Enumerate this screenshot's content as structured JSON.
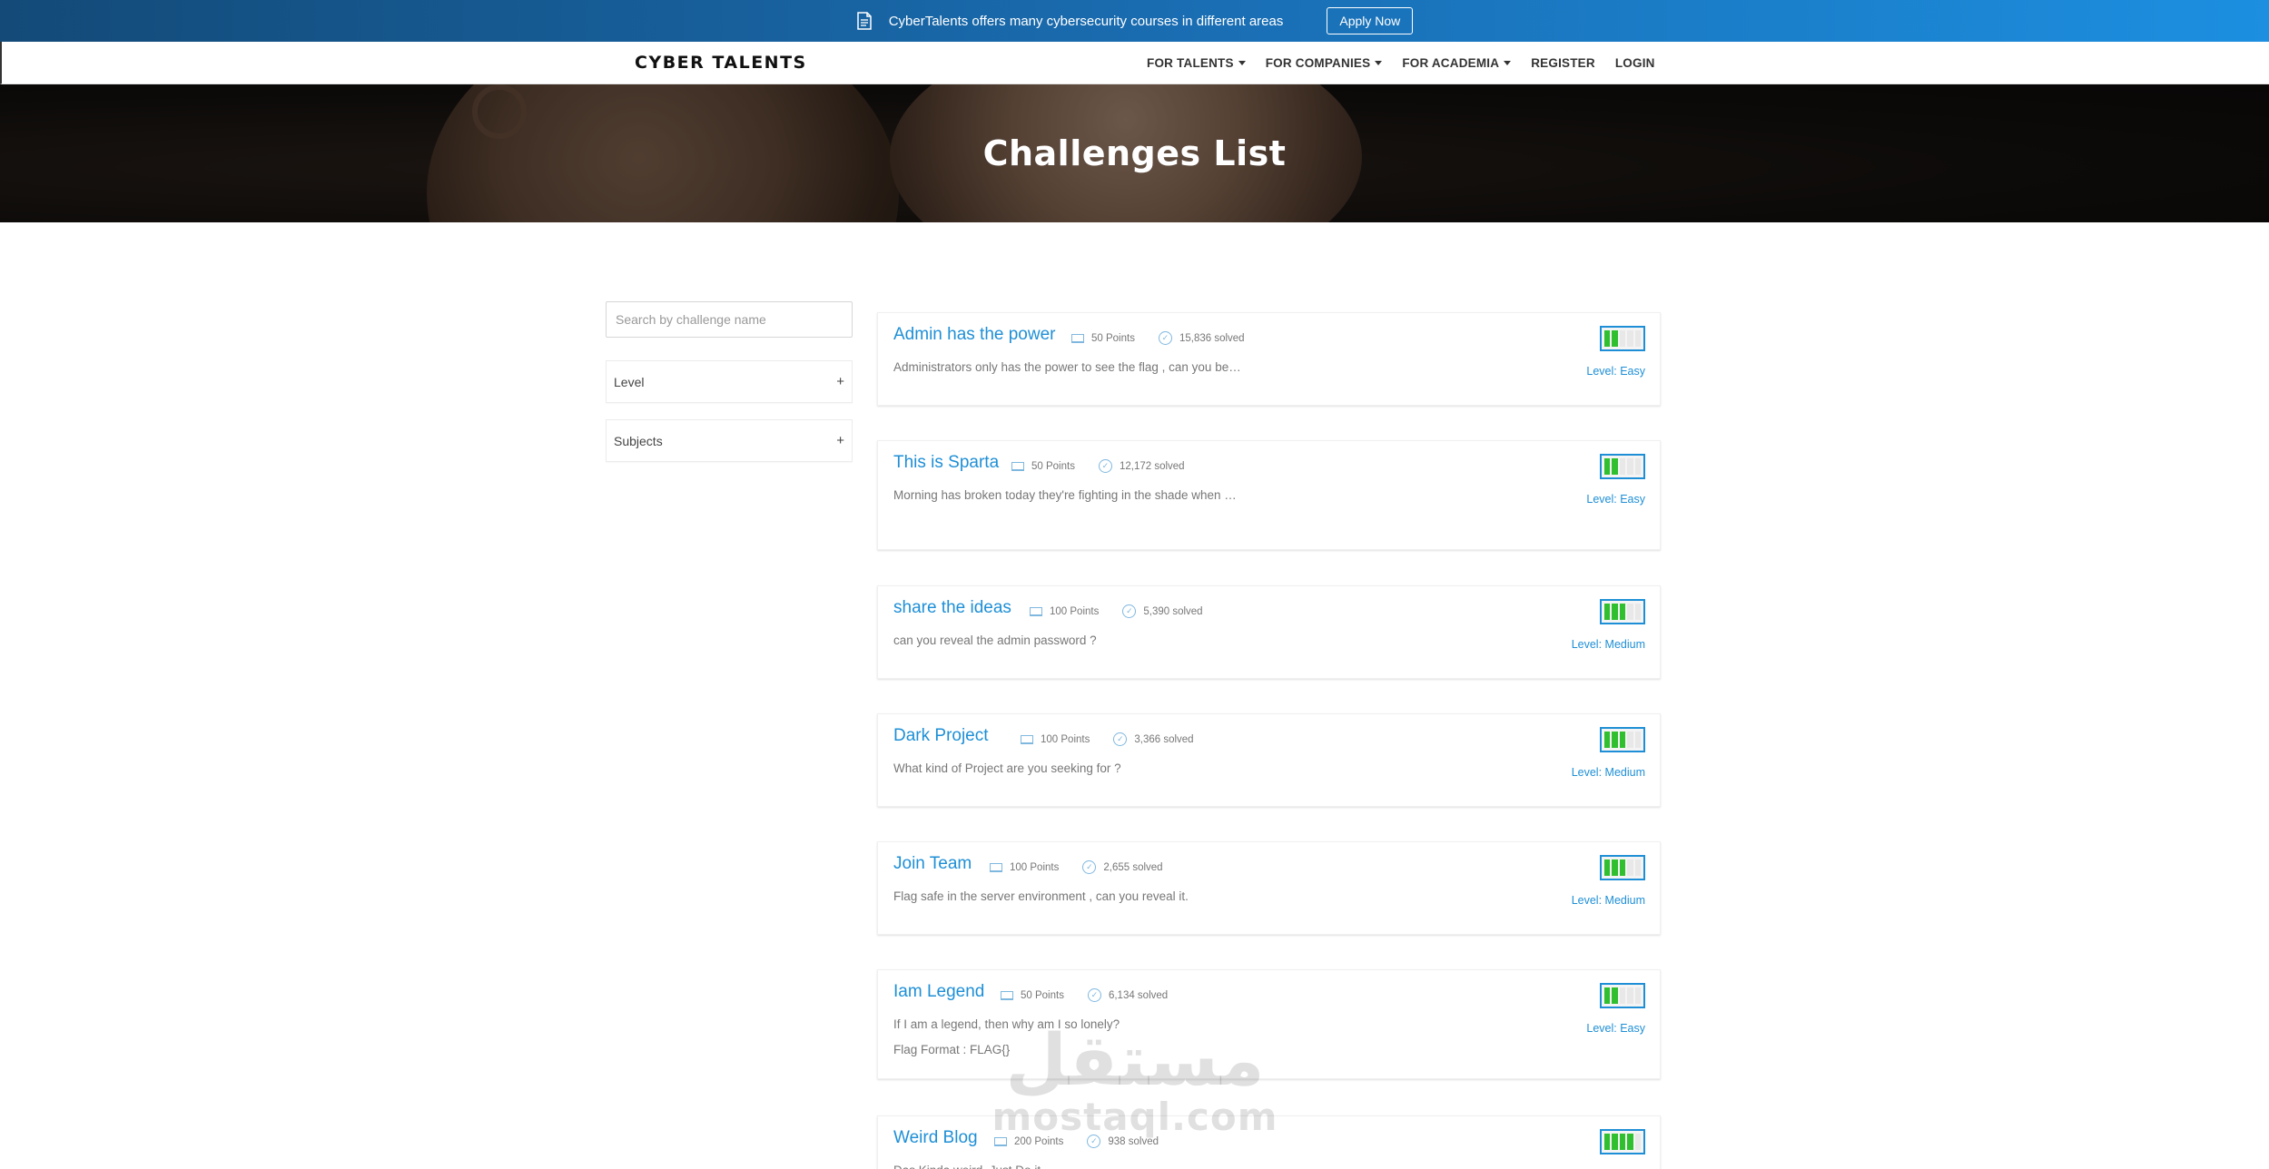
{
  "promo": {
    "text": "CyberTalents offers many cybersecurity courses in different areas",
    "apply_label": "Apply Now"
  },
  "nav": {
    "logo": "CYBER TALENTS",
    "items": [
      {
        "label": "FOR TALENTS",
        "dropdown": true
      },
      {
        "label": "FOR COMPANIES",
        "dropdown": true
      },
      {
        "label": "FOR ACADEMIA",
        "dropdown": true
      },
      {
        "label": "REGISTER",
        "dropdown": false
      },
      {
        "label": "LOGIN",
        "dropdown": false
      }
    ]
  },
  "hero": {
    "title": "Challenges List"
  },
  "sidebar": {
    "search_placeholder": "Search by challenge name",
    "filters": [
      {
        "label": "Level",
        "toggle": "+"
      },
      {
        "label": "Subjects",
        "toggle": "+"
      }
    ]
  },
  "challenges": [
    {
      "title": "Admin has the power",
      "points": "50 Points",
      "solved": "15,836 solved",
      "desc": [
        "Administrators only has the power to see the flag , can you be…"
      ],
      "level_label": "Level: Easy",
      "level_fill": 2,
      "level_max": 5
    },
    {
      "title": "This is Sparta",
      "points": "50 Points",
      "solved": "12,172 solved",
      "desc": [
        "Morning has broken today they're fighting in the shade when …"
      ],
      "level_label": "Level: Easy",
      "level_fill": 2,
      "level_max": 5
    },
    {
      "title": "share the ideas",
      "points": "100 Points",
      "solved": "5,390 solved",
      "desc": [
        "can you reveal the admin password ?"
      ],
      "level_label": "Level: Medium",
      "level_fill": 3,
      "level_max": 5
    },
    {
      "title": "Dark Project",
      "points": "100 Points",
      "solved": "3,366 solved",
      "desc": [
        "What kind of Project are you seeking for ?"
      ],
      "level_label": "Level: Medium",
      "level_fill": 3,
      "level_max": 5
    },
    {
      "title": "Join Team",
      "points": "100 Points",
      "solved": "2,655 solved",
      "desc": [
        "Flag safe in the server environment , can you reveal it."
      ],
      "level_label": "Level: Medium",
      "level_fill": 3,
      "level_max": 5
    },
    {
      "title": "Iam Legend",
      "points": "50 Points",
      "solved": "6,134 solved",
      "desc": [
        "If I am a legend, then why am I so lonely?",
        "Flag Format : FLAG{}"
      ],
      "level_label": "Level: Easy",
      "level_fill": 2,
      "level_max": 5
    },
    {
      "title": "Weird Blog",
      "points": "200 Points",
      "solved": "938 solved",
      "desc": [
        "Das Kinda weird, Just Do it"
      ],
      "level_label": "",
      "level_fill": 4,
      "level_max": 5
    }
  ],
  "watermark": {
    "arabic": "مستقل",
    "latin": "mostaql.com"
  },
  "colors": {
    "accent": "#1e8fd6",
    "level_green": "#2fbf2f",
    "promo_start": "#134a78",
    "promo_end": "#1c8fe0"
  },
  "icons": {
    "promo": "document-icon",
    "points": "laptop-icon",
    "solved": "check-circle-icon"
  }
}
